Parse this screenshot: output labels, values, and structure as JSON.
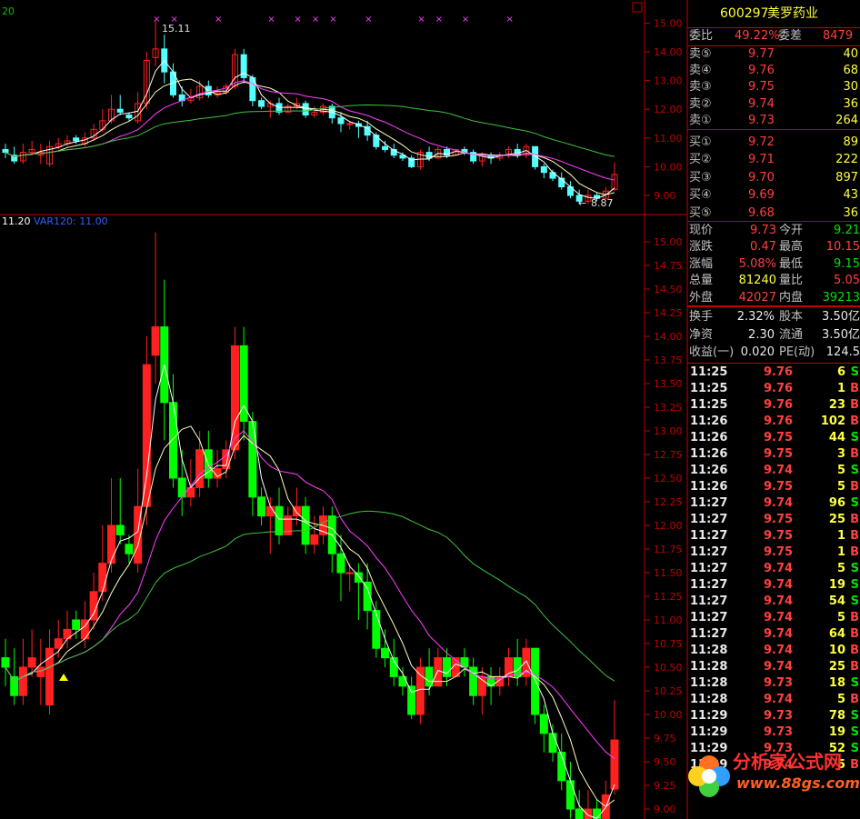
{
  "stock": {
    "code": "600297",
    "name": "美罗药业"
  },
  "top_chart": {
    "y_ticks": [
      "15.00",
      "14.00",
      "13.00",
      "12.00",
      "11.00",
      "10.00",
      "9.00"
    ],
    "high_label": "15.11",
    "low_label": "8.87",
    "left_value": "20"
  },
  "bottom_chart": {
    "indicator_value": "11.20",
    "indicator_label": "VAR120: 11.00",
    "y_ticks": [
      "15.00",
      "14.75",
      "14.50",
      "14.25",
      "14.00",
      "13.75",
      "13.50",
      "13.25",
      "13.00",
      "12.75",
      "12.50",
      "12.25",
      "12.00",
      "11.75",
      "11.50",
      "11.25",
      "11.00",
      "10.75",
      "10.50",
      "10.25",
      "10.00",
      "9.75",
      "9.50",
      "9.25",
      "9.00"
    ]
  },
  "order_book": {
    "ratio_label": "委比",
    "ratio_value": "49.22%",
    "diff_label": "委差",
    "diff_value": "8479",
    "asks": [
      {
        "label": "卖⑤",
        "price": "9.77",
        "vol": "40"
      },
      {
        "label": "卖④",
        "price": "9.76",
        "vol": "68"
      },
      {
        "label": "卖③",
        "price": "9.75",
        "vol": "30"
      },
      {
        "label": "卖②",
        "price": "9.74",
        "vol": "36"
      },
      {
        "label": "卖①",
        "price": "9.73",
        "vol": "264"
      }
    ],
    "bids": [
      {
        "label": "买①",
        "price": "9.72",
        "vol": "89"
      },
      {
        "label": "买②",
        "price": "9.71",
        "vol": "222"
      },
      {
        "label": "买③",
        "price": "9.70",
        "vol": "897"
      },
      {
        "label": "买④",
        "price": "9.69",
        "vol": "43"
      },
      {
        "label": "买⑤",
        "price": "9.68",
        "vol": "36"
      }
    ]
  },
  "quote": {
    "rows": [
      {
        "l1": "现价",
        "v1": "9.73",
        "l2": "今开",
        "v2": "9.21"
      },
      {
        "l1": "涨跌",
        "v1": "0.47",
        "l2": "最高",
        "v2": "10.15"
      },
      {
        "l1": "涨幅",
        "v1": "5.08%",
        "l2": "最低",
        "v2": "9.15"
      },
      {
        "l1": "总量",
        "v1": "81240",
        "l2": "量比",
        "v2": "5.05"
      },
      {
        "l1": "外盘",
        "v1": "42027",
        "l2": "内盘",
        "v2": "39213"
      }
    ],
    "rows2": [
      {
        "l1": "换手",
        "v1": "2.32%",
        "l2": "股本",
        "v2": "3.50亿"
      },
      {
        "l1": "净资",
        "v1": "2.30",
        "l2": "流通",
        "v2": "3.50亿"
      },
      {
        "l1": "收益(一)",
        "v1": "0.020",
        "l2": "PE(动)",
        "v2": "124.5"
      }
    ]
  },
  "trades": [
    {
      "t": "11:25",
      "p": "9.76",
      "v": "6",
      "s": "S"
    },
    {
      "t": "11:25",
      "p": "9.76",
      "v": "1",
      "s": "B"
    },
    {
      "t": "11:25",
      "p": "9.76",
      "v": "23",
      "s": "B"
    },
    {
      "t": "11:26",
      "p": "9.76",
      "v": "102",
      "s": "B"
    },
    {
      "t": "11:26",
      "p": "9.75",
      "v": "44",
      "s": "S"
    },
    {
      "t": "11:26",
      "p": "9.75",
      "v": "3",
      "s": "B"
    },
    {
      "t": "11:26",
      "p": "9.74",
      "v": "5",
      "s": "S"
    },
    {
      "t": "11:26",
      "p": "9.75",
      "v": "5",
      "s": "B"
    },
    {
      "t": "11:27",
      "p": "9.74",
      "v": "96",
      "s": "S"
    },
    {
      "t": "11:27",
      "p": "9.75",
      "v": "25",
      "s": "B"
    },
    {
      "t": "11:27",
      "p": "9.75",
      "v": "1",
      "s": "B"
    },
    {
      "t": "11:27",
      "p": "9.75",
      "v": "1",
      "s": "B"
    },
    {
      "t": "11:27",
      "p": "9.74",
      "v": "5",
      "s": "S"
    },
    {
      "t": "11:27",
      "p": "9.74",
      "v": "19",
      "s": "S"
    },
    {
      "t": "11:27",
      "p": "9.74",
      "v": "54",
      "s": "S"
    },
    {
      "t": "11:27",
      "p": "9.74",
      "v": "5",
      "s": "B"
    },
    {
      "t": "11:27",
      "p": "9.74",
      "v": "64",
      "s": "B"
    },
    {
      "t": "11:28",
      "p": "9.74",
      "v": "10",
      "s": "B"
    },
    {
      "t": "11:28",
      "p": "9.74",
      "v": "25",
      "s": "B"
    },
    {
      "t": "11:28",
      "p": "9.73",
      "v": "18",
      "s": "S"
    },
    {
      "t": "11:28",
      "p": "9.74",
      "v": "5",
      "s": "B"
    },
    {
      "t": "11:29",
      "p": "9.73",
      "v": "78",
      "s": "S"
    },
    {
      "t": "11:29",
      "p": "9.73",
      "v": "19",
      "s": "S"
    },
    {
      "t": "11:29",
      "p": "9.73",
      "v": "52",
      "s": "S"
    },
    {
      "t": "11:29",
      "p": "9.74",
      "v": "5",
      "s": "B"
    }
  ],
  "watermark": {
    "title": "分析家公式网",
    "url": "www.88gs.com"
  },
  "colors": {
    "up": "#ff2020",
    "down": "#00ff00",
    "top_down": "#54ffff",
    "ma5": "#ffffff",
    "ma10": "#ffff80",
    "ma20": "#ff40ff",
    "ma60": "#40c040",
    "border": "#c00000"
  }
}
